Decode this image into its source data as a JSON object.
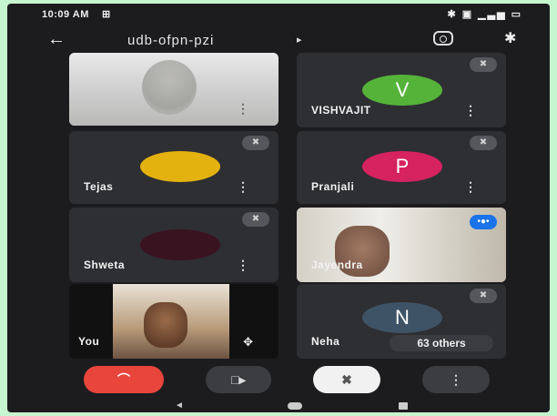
{
  "status_bar": {
    "time": "10:09 AM",
    "notification": "⊞",
    "right_icons": "✱ ▣ ▁▃▅ ▭"
  },
  "app_bar": {
    "back": "←",
    "meeting_code": "udb-ofpn-pzi",
    "caret": "▸",
    "switch_camera": "",
    "bluetooth": "✱"
  },
  "tiles": [
    {
      "name": "",
      "more": "⋮",
      "mic": "✖"
    },
    {
      "name": "VISHVAJIT",
      "initial": "V",
      "color": "#55b33a",
      "more": "⋮",
      "mic": "✖"
    },
    {
      "name": "Tejas",
      "color": "#e3b20f",
      "more": "⋮",
      "mic": "✖"
    },
    {
      "name": "Pranjali",
      "initial": "P",
      "color": "#d6225f",
      "more": "⋮",
      "mic": "✖"
    },
    {
      "name": "Shweta",
      "color": "#3a1320",
      "more": "⋮",
      "mic": "✖"
    },
    {
      "name": "Jayendra",
      "badge": "•●•"
    },
    {
      "name": "You",
      "ctrl": "✥"
    },
    {
      "name": "Neha",
      "initial": "N",
      "color": "#3f5366",
      "others": "63 others",
      "mic": "✖"
    }
  ],
  "controls": {
    "end_call": "⌒",
    "camera": "□▸",
    "mic": "✖",
    "more": "⋮"
  },
  "nav": {
    "back": "◄"
  }
}
